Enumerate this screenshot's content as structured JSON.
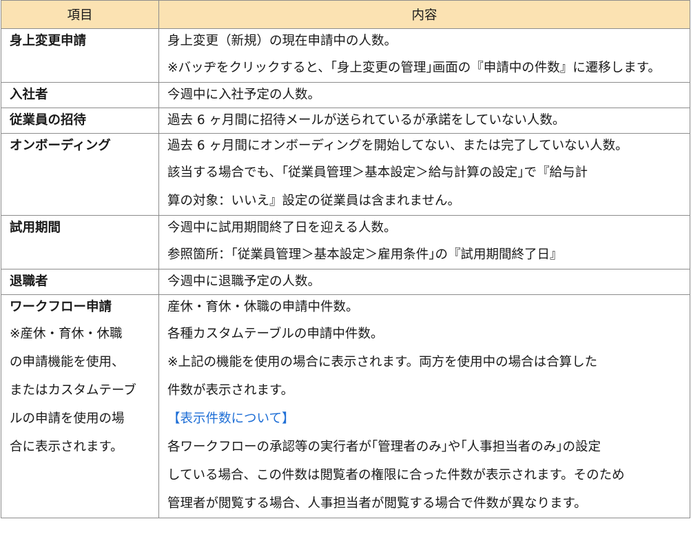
{
  "header": {
    "col_item": "項目",
    "col_content": "内容"
  },
  "rows": [
    {
      "label": "身上変更申請",
      "lines": [
        "身上変更（新規）の現在申請中の人数。",
        "※バッヂをクリックすると、｢身上変更の管理｣画面の『申請中の件数』に遷移します。"
      ]
    },
    {
      "label": "入社者",
      "lines": [
        "今週中に入社予定の人数。"
      ]
    },
    {
      "label": "従業員の招待",
      "lines": [
        "過去 6 ヶ月間に招待メールが送られているが承諾をしていない人数。"
      ]
    },
    {
      "label": "オンボーディング",
      "lines": [
        "過去 6 ヶ月間にオンボーディングを開始してない、または完了していない人数。",
        "該当する場合でも、｢従業員管理＞基本設定＞給与計算の設定｣で『給与計",
        "算の対象：いいえ』設定の従業員は含まれません。"
      ]
    },
    {
      "label": "試用期間",
      "lines": [
        "今週中に試用期間終了日を迎える人数。",
        "参照箇所：｢従業員管理＞基本設定＞雇用条件｣の『試用期間終了日』"
      ]
    },
    {
      "label": "退職者",
      "lines": [
        "今週中に退職予定の人数。"
      ]
    },
    {
      "label": "ワークフロー申請",
      "label_notes": [
        "※産休・育休・休職",
        "の申請機能を使用、",
        "またはカスタムテーブ",
        "ルの申請を使用の場",
        "合に表示されます。"
      ],
      "lines": [
        "産休・育休・休職の申請中件数。",
        "各種カスタムテーブルの申請中件数。",
        "※上記の機能を使用の場合に表示されます。両方を使用中の場合は合算した",
        "件数が表示されます。",
        "【表示件数について】",
        "各ワークフローの承認等の実行者が｢管理者のみ｣や｢人事担当者のみ｣の設定",
        "している場合、この件数は閲覧者の権限に合った件数が表示されます。そのため",
        "管理者が閲覧する場合、人事担当者が閲覧する場合で件数が異なります。"
      ]
    }
  ],
  "colors": {
    "header_bg": "#fbe2b2",
    "border": "#8c8c8c",
    "link_blue": "#1f6fd6"
  }
}
